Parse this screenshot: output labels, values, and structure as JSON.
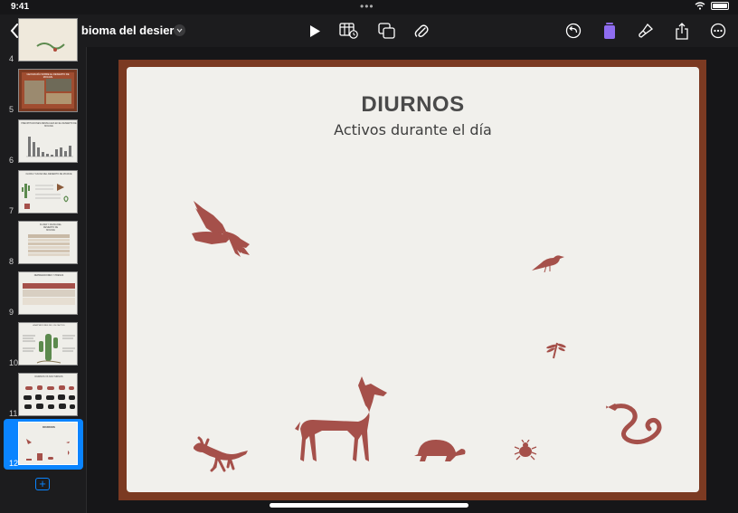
{
  "status": {
    "time": "9:41"
  },
  "toolbar": {
    "title": "El bioma del desierto",
    "icons": [
      "back-chevron-icon",
      "sidebar-icon",
      "play-icon",
      "insert-table-icon",
      "shapes-icon",
      "attachment-icon",
      "undo-icon",
      "format-icon",
      "brush-icon",
      "share-icon",
      "more-icon"
    ]
  },
  "navigator": {
    "slides": [
      {
        "number": "4",
        "heading": ""
      },
      {
        "number": "5",
        "heading": "GEOGRAFÍA SOBRE EL DESIERTO DE MOJAVE"
      },
      {
        "number": "6",
        "heading": "PRECIPITACIONES MENSUALES EN EL DESIERTO DE MOJAVE"
      },
      {
        "number": "7",
        "heading": "FLORA Y FAUNA DEL DESIERTO DE MOJAVE"
      },
      {
        "number": "8",
        "heading": "FLORA Y FAUNA DEL DESIERTO DE MOJAVE"
      },
      {
        "number": "9",
        "heading": "DEPREDADORES Y PRESAS"
      },
      {
        "number": "10",
        "heading": "ADAPTACIONES DE LOS CACTUS"
      },
      {
        "number": "11",
        "heading": "DIURNOS VS NOCTURNOS"
      },
      {
        "number": "12",
        "heading": "DIURNOS"
      }
    ],
    "selected": "12"
  },
  "slide": {
    "title": "DIURNOS",
    "subtitle": "Activos durante el día",
    "silhouette_color": "#a5504a",
    "frame_color": "#7b3a22"
  }
}
